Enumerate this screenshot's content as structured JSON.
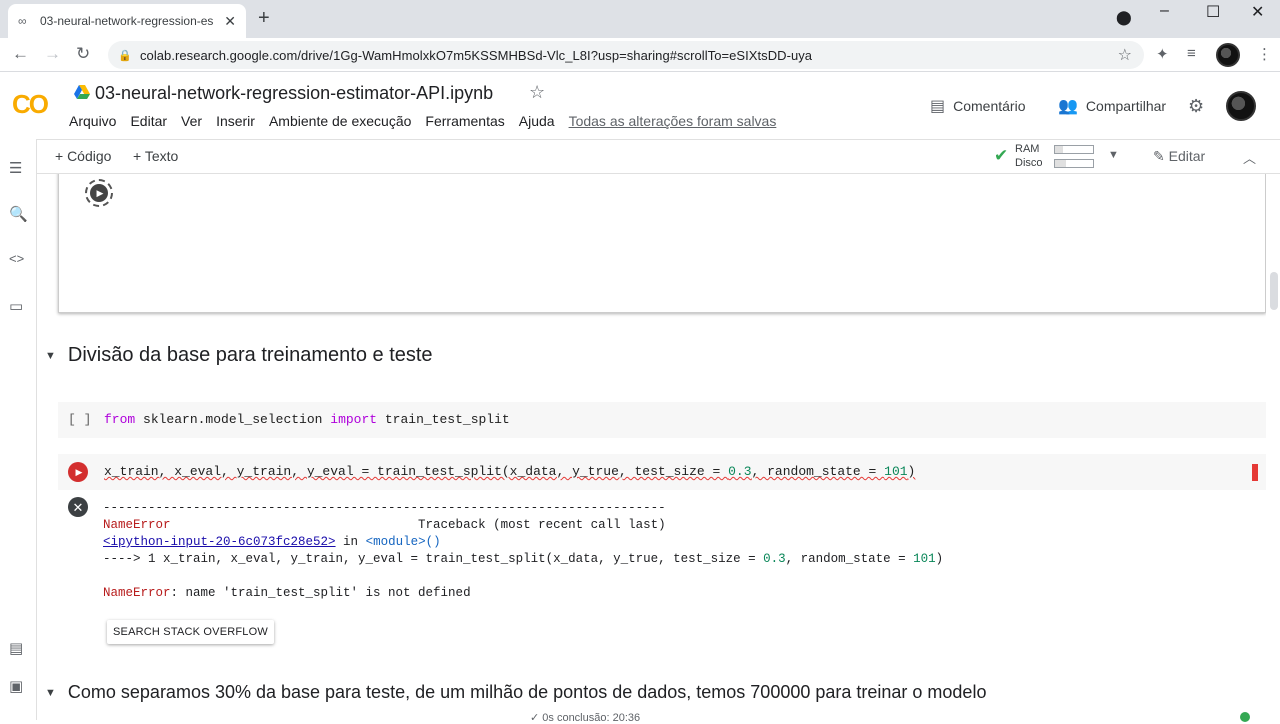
{
  "browser": {
    "tab_title": "03-neural-network-regression-es",
    "url": "colab.research.google.com/drive/1Gg-WamHmolxkO7m5KSSMHBSd-Vlc_L8I?usp=sharing#scrollTo=eSIXtsDD-uya"
  },
  "header": {
    "logo": "CO",
    "notebook_title": "03-neural-network-regression-estimator-API.ipynb",
    "menu": [
      "Arquivo",
      "Editar",
      "Ver",
      "Inserir",
      "Ambiente de execução",
      "Ferramentas",
      "Ajuda"
    ],
    "saved_status": "Todas as alterações foram salvas",
    "comment_label": "Comentário",
    "share_label": "Compartilhar"
  },
  "toolbar": {
    "add_code": "+ Código",
    "add_text": "+ Texto",
    "ram_label": "RAM",
    "disk_label": "Disco",
    "edit_label": "Editar"
  },
  "sections": {
    "split_title": "Divisão da base para treinamento e teste",
    "next_title": "Como separamos 30% da base para teste, de um milhão de pontos de dados, temos 700000 para treinar o modelo"
  },
  "cells": {
    "import_prompt": "[ ]",
    "import_code": {
      "kw1": "from",
      "mod": " sklearn.model_selection ",
      "kw2": "import",
      "name": " train_test_split"
    },
    "split_code": {
      "lhs": "x_train, x_eval, y_train, y_eval = train_test_split(x_data, y_true, test_size = ",
      "num1": "0.3",
      "mid": ", random_state = ",
      "num2": "101",
      "end": ")"
    }
  },
  "output": {
    "dashes": "---------------------------------------------------------------------------",
    "error_name": "NameError",
    "traceback_label": "                                 Traceback (most recent call last)",
    "input_link": "<ipython-input-20-6c073fc28e52>",
    "in_text": " in ",
    "module_text": "<module>()",
    "arrow_line": "----> 1 x_train, x_eval, y_train, y_eval = train_test_split(x_data, y_true, test_size = ",
    "arrow_num1": "0.3",
    "arrow_mid": ", random_state = ",
    "arrow_num2": "101",
    "arrow_end": ")",
    "error_message_name": "NameError",
    "error_message": ": name 'train_test_split' is not defined",
    "search_button": "SEARCH STACK OVERFLOW"
  },
  "status": {
    "text": "✓ 0s   conclusão: 20:36"
  },
  "colors": {
    "run_error": "#d32f2f",
    "keyword": "#af00db",
    "number": "#098658",
    "ok_green": "#34a853"
  }
}
